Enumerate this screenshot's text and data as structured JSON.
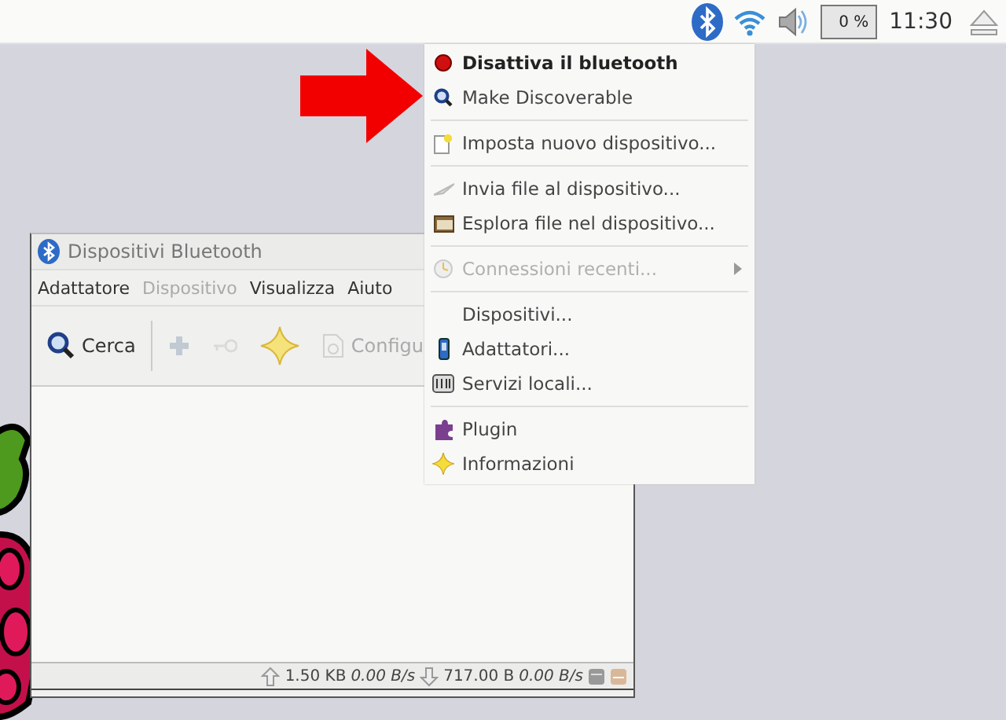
{
  "panel": {
    "cpu": "0 %",
    "clock": "11:30"
  },
  "window": {
    "title": "Dispositivi Bluetooth",
    "menubar": [
      {
        "label": "Adattatore",
        "disabled": false
      },
      {
        "label": "Dispositivo",
        "disabled": true
      },
      {
        "label": "Visualizza",
        "disabled": false
      },
      {
        "label": "Aiuto",
        "disabled": false
      }
    ],
    "toolbar": [
      {
        "kind": "search",
        "label": "Cerca",
        "disabled": false
      },
      {
        "kind": "add",
        "disabled": true
      },
      {
        "kind": "key",
        "disabled": true
      },
      {
        "kind": "star",
        "disabled": false
      },
      {
        "kind": "setup",
        "label": "Configu",
        "disabled": true
      }
    ],
    "status_bar": {
      "uploaded": "1.50 KB",
      "upload_rate": "0.00 B/s",
      "downloaded": "717.00 B",
      "download_rate": "0.00 B/s"
    }
  },
  "menu": [
    {
      "kind": "item",
      "label": "Disattiva il bluetooth",
      "bold": true,
      "disabled": false
    },
    {
      "kind": "item",
      "label": "Make Discoverable",
      "bold": false,
      "disabled": false
    },
    {
      "kind": "separator"
    },
    {
      "kind": "item",
      "label": "Imposta nuovo dispositivo...",
      "bold": false,
      "disabled": false
    },
    {
      "kind": "separator"
    },
    {
      "kind": "item",
      "label": "Invia file al dispositivo...",
      "bold": false,
      "disabled": false
    },
    {
      "kind": "item",
      "label": "Esplora file nel dispositivo...",
      "bold": false,
      "disabled": false
    },
    {
      "kind": "separator"
    },
    {
      "kind": "item",
      "label": "Connessioni recenti...",
      "bold": false,
      "disabled": true,
      "submenu": true
    },
    {
      "kind": "separator"
    },
    {
      "kind": "item",
      "label": "Dispositivi...",
      "bold": false,
      "disabled": false
    },
    {
      "kind": "item",
      "label": "Adattatori...",
      "bold": false,
      "disabled": false
    },
    {
      "kind": "item",
      "label": "Servizi locali...",
      "bold": false,
      "disabled": false
    },
    {
      "kind": "separator"
    },
    {
      "kind": "item",
      "label": "Plugin",
      "bold": false,
      "disabled": false
    },
    {
      "kind": "item",
      "label": "Informazioni",
      "bold": false,
      "disabled": false
    }
  ]
}
